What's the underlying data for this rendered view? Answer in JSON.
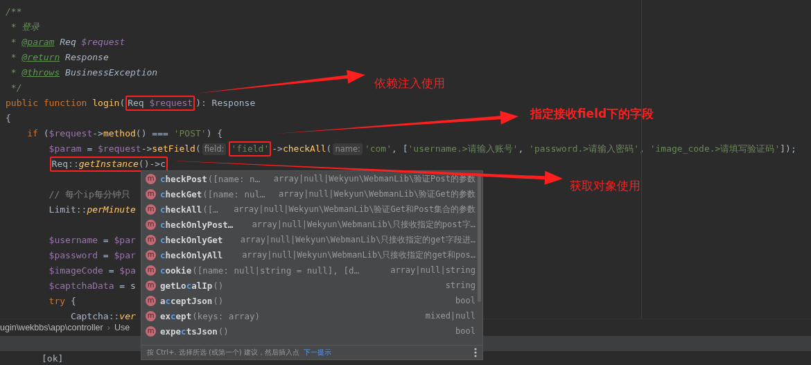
{
  "editor": {
    "lines": [
      {
        "kind": "code",
        "segments": [
          {
            "kind": "code",
            "boxed": false,
            "tokens": [
              {
                "t": "/**",
                "kind": "doc"
              }
            ]
          }
        ]
      },
      {
        "kind": "code",
        "segments": [
          {
            "kind": "code",
            "boxed": false,
            "tokens": [
              {
                "t": " * 登录",
                "kind": "doc"
              }
            ]
          }
        ]
      },
      {
        "kind": "code",
        "segments": [
          {
            "kind": "code",
            "boxed": false,
            "tokens": [
              {
                "t": " * ",
                "kind": "doc"
              },
              {
                "t": "@param",
                "kind": "doctag"
              },
              {
                "t": " Req",
                "kind": "doctype"
              },
              {
                "t": " $request",
                "kind": "docvar"
              }
            ]
          }
        ]
      },
      {
        "kind": "code",
        "segments": [
          {
            "kind": "code",
            "boxed": false,
            "tokens": [
              {
                "t": " * ",
                "kind": "doc"
              },
              {
                "t": "@return",
                "kind": "doctag"
              },
              {
                "t": " Response",
                "kind": "doctype"
              }
            ]
          }
        ]
      },
      {
        "kind": "code",
        "segments": [
          {
            "kind": "code",
            "boxed": false,
            "tokens": [
              {
                "t": " * ",
                "kind": "doc"
              },
              {
                "t": "@throws",
                "kind": "doctag"
              },
              {
                "t": " BusinessException",
                "kind": "doctype"
              }
            ]
          }
        ]
      },
      {
        "kind": "code",
        "segments": [
          {
            "kind": "code",
            "boxed": false,
            "tokens": [
              {
                "t": " */",
                "kind": "doc"
              }
            ]
          }
        ]
      },
      {
        "kind": "code",
        "segments": [
          {
            "kind": "code",
            "boxed": false,
            "tokens": [
              {
                "t": "public function ",
                "kind": "keyword"
              },
              {
                "t": "login",
                "kind": "func"
              },
              {
                "t": "(",
                "kind": "plain"
              }
            ]
          },
          {
            "kind": "code",
            "boxed": true,
            "tokens": [
              {
                "t": "Req ",
                "kind": "plain"
              },
              {
                "t": "$request",
                "kind": "var"
              }
            ]
          },
          {
            "kind": "code",
            "boxed": false,
            "tokens": [
              {
                "t": "): Response",
                "kind": "plain"
              }
            ]
          }
        ]
      },
      {
        "kind": "code",
        "segments": [
          {
            "kind": "code",
            "boxed": false,
            "tokens": [
              {
                "t": "{",
                "kind": "plain"
              }
            ]
          }
        ],
        "children": [
          {
            "kind": "code",
            "segments": [
              {
                "kind": "code",
                "boxed": false,
                "tokens": [
                  {
                    "t": "if",
                    "kind": "keyword"
                  },
                  {
                    "t": " (",
                    "kind": "plain"
                  },
                  {
                    "t": "$request",
                    "kind": "var"
                  },
                  {
                    "t": "->",
                    "kind": "plain"
                  },
                  {
                    "t": "method",
                    "kind": "func"
                  },
                  {
                    "t": "() === ",
                    "kind": "plain"
                  },
                  {
                    "t": "'POST'",
                    "kind": "string"
                  },
                  {
                    "t": ") {",
                    "kind": "plain"
                  }
                ]
              }
            ],
            "children": [
              {
                "kind": "code",
                "segments": [
                  {
                    "kind": "code",
                    "boxed": false,
                    "tokens": [
                      {
                        "t": "$param",
                        "kind": "var"
                      },
                      {
                        "t": " = ",
                        "kind": "plain"
                      },
                      {
                        "t": "$request",
                        "kind": "var"
                      },
                      {
                        "t": "->",
                        "kind": "plain"
                      },
                      {
                        "t": "setField",
                        "kind": "func"
                      },
                      {
                        "t": "(",
                        "kind": "plain"
                      }
                    ]
                  },
                  {
                    "kind": "hint",
                    "boxed": false,
                    "tokens": [
                      {
                        "t": "field:",
                        "kind": "hint"
                      }
                    ]
                  },
                  {
                    "kind": "code",
                    "boxed": true,
                    "tokens": [
                      {
                        "t": "'field'",
                        "kind": "string"
                      }
                    ]
                  },
                  {
                    "kind": "code",
                    "boxed": false,
                    "tokens": [
                      {
                        "t": "->",
                        "kind": "plain"
                      },
                      {
                        "t": "checkAll",
                        "kind": "func"
                      },
                      {
                        "t": "(",
                        "kind": "plain"
                      }
                    ]
                  },
                  {
                    "kind": "hint",
                    "boxed": false,
                    "tokens": [
                      {
                        "t": "name:",
                        "kind": "hint"
                      }
                    ]
                  },
                  {
                    "kind": "code",
                    "boxed": false,
                    "tokens": [
                      {
                        "t": "'com'",
                        "kind": "string"
                      },
                      {
                        "t": ", [",
                        "kind": "plain"
                      },
                      {
                        "t": "'username.>请输入账号'",
                        "kind": "string"
                      },
                      {
                        "t": ", ",
                        "kind": "plain"
                      },
                      {
                        "t": "'password.>请输入密码'",
                        "kind": "string"
                      },
                      {
                        "t": ", ",
                        "kind": "plain"
                      },
                      {
                        "t": "'image_code.>请填写验证码'",
                        "kind": "string"
                      },
                      {
                        "t": "]);",
                        "kind": "plain"
                      }
                    ]
                  }
                ]
              },
              {
                "kind": "code",
                "segments": [
                  {
                    "kind": "code",
                    "boxed": true,
                    "tokens": [
                      {
                        "t": "Req::",
                        "kind": "plain"
                      },
                      {
                        "t": "getInstance",
                        "kind": "static"
                      },
                      {
                        "t": "()->c",
                        "kind": "plain"
                      }
                    ]
                  }
                ]
              },
              {
                "kind": "blank"
              },
              {
                "kind": "code",
                "segments": [
                  {
                    "kind": "code",
                    "boxed": false,
                    "tokens": [
                      {
                        "t": "// 每个ip每分钟只",
                        "kind": "comment"
                      }
                    ]
                  }
                ]
              },
              {
                "kind": "code",
                "segments": [
                  {
                    "kind": "code",
                    "boxed": false,
                    "tokens": [
                      {
                        "t": "Limit::",
                        "kind": "plain"
                      },
                      {
                        "t": "perMinute",
                        "kind": "static"
                      }
                    ]
                  }
                ]
              },
              {
                "kind": "blank"
              },
              {
                "kind": "code",
                "segments": [
                  {
                    "kind": "code",
                    "boxed": false,
                    "tokens": [
                      {
                        "t": "$username",
                        "kind": "var"
                      },
                      {
                        "t": " = ",
                        "kind": "plain"
                      },
                      {
                        "t": "$par",
                        "kind": "var"
                      }
                    ]
                  }
                ]
              },
              {
                "kind": "code",
                "segments": [
                  {
                    "kind": "code",
                    "boxed": false,
                    "tokens": [
                      {
                        "t": "$password",
                        "kind": "var"
                      },
                      {
                        "t": " = ",
                        "kind": "plain"
                      },
                      {
                        "t": "$par",
                        "kind": "var"
                      }
                    ]
                  }
                ]
              },
              {
                "kind": "code",
                "segments": [
                  {
                    "kind": "code",
                    "boxed": false,
                    "tokens": [
                      {
                        "t": "$imageCode",
                        "kind": "var"
                      },
                      {
                        "t": " = ",
                        "kind": "plain"
                      },
                      {
                        "t": "$pa",
                        "kind": "var"
                      }
                    ]
                  }
                ]
              },
              {
                "kind": "code",
                "segments": [
                  {
                    "kind": "code",
                    "boxed": false,
                    "tokens": [
                      {
                        "t": "$captchaData",
                        "kind": "var"
                      },
                      {
                        "t": " = s",
                        "kind": "plain"
                      }
                    ]
                  }
                ]
              },
              {
                "kind": "code",
                "segments": [
                  {
                    "kind": "code",
                    "boxed": false,
                    "tokens": [
                      {
                        "t": "try",
                        "kind": "keyword"
                      },
                      {
                        "t": " {",
                        "kind": "plain"
                      }
                    ]
                  }
                ],
                "children": [
                  {
                    "kind": "code",
                    "segments": [
                      {
                        "kind": "code",
                        "boxed": false,
                        "tokens": [
                          {
                            "t": "Captcha::",
                            "kind": "plain"
                          },
                          {
                            "t": "ver",
                            "kind": "static"
                          }
                        ]
                      }
                    ]
                  }
                ]
              }
            ]
          }
        ]
      }
    ]
  },
  "completion_popup": {
    "items": [
      {
        "icon_letter": "m",
        "name": [
          {
            "text": "c",
            "match": true
          },
          {
            "text": "heckPost",
            "match": false
          }
        ],
        "params": "([name: n…",
        "type": "array|null|Wekyun\\WebmanLib\\验证Post的参数"
      },
      {
        "icon_letter": "m",
        "name": [
          {
            "text": "c",
            "match": true
          },
          {
            "text": "heckGet",
            "match": false
          }
        ],
        "params": "([name: nul…",
        "type": "array|null|Wekyun\\WebmanLib\\验证Get的参数"
      },
      {
        "icon_letter": "m",
        "name": [
          {
            "text": "c",
            "match": true
          },
          {
            "text": "heckAll",
            "match": false
          }
        ],
        "params": "([…",
        "type": "array|null|Wekyun\\WebmanLib\\验证Get和Post集合的参数"
      },
      {
        "icon_letter": "m",
        "name": [
          {
            "text": "c",
            "match": true
          },
          {
            "text": "heckOnlyPost…",
            "match": false
          }
        ],
        "type": "array|null|Wekyun\\WebmanLib\\只接收指定的post字…"
      },
      {
        "icon_letter": "m",
        "name": [
          {
            "text": "c",
            "match": true
          },
          {
            "text": "heckOnlyGet",
            "match": false
          }
        ],
        "type": "array|null|Wekyun\\WebmanLib\\只接收指定的get字段进…"
      },
      {
        "icon_letter": "m",
        "name": [
          {
            "text": "c",
            "match": true
          },
          {
            "text": "heckOnlyAll",
            "match": false
          }
        ],
        "type": "array|null|Wekyun\\WebmanLib\\只接收指定的get和pos…"
      },
      {
        "icon_letter": "m",
        "name": [
          {
            "text": "c",
            "match": true
          },
          {
            "text": "ookie",
            "match": false
          }
        ],
        "params": "([name: null|string = null], [d…",
        "type": "array|null|string"
      },
      {
        "icon_letter": "m",
        "name": [
          {
            "text": "getLo",
            "match": false
          },
          {
            "text": "c",
            "match": true
          },
          {
            "text": "alIp",
            "match": false
          }
        ],
        "params": "()",
        "type": "string"
      },
      {
        "icon_letter": "m",
        "name": [
          {
            "text": "a",
            "match": false
          },
          {
            "text": "c",
            "match": true
          },
          {
            "text": "ceptJson",
            "match": false
          }
        ],
        "params": "()",
        "type": "bool"
      },
      {
        "icon_letter": "m",
        "name": [
          {
            "text": "ex",
            "match": false
          },
          {
            "text": "c",
            "match": true
          },
          {
            "text": "ept",
            "match": false
          }
        ],
        "params": "(keys: array)",
        "type": "mixed|null"
      },
      {
        "icon_letter": "m",
        "name": [
          {
            "text": "expe",
            "match": false
          },
          {
            "text": "c",
            "match": true
          },
          {
            "text": "tsJson",
            "match": false
          }
        ],
        "params": "()",
        "type": "bool"
      }
    ],
    "footer": {
      "hint": "按 Ctrl+. 选择所选 (或第一个) 建议，然后插入点",
      "link": "下一提示"
    }
  },
  "breadcrumb": {
    "path": "ugin\\wekbbs\\app\\controller",
    "separator": "›",
    "current": "Use"
  },
  "console": {
    "text": "[ok]"
  },
  "annotations": [
    {
      "label": "依赖注入使用",
      "bold": false
    },
    {
      "label": "指定接收field下的字段",
      "bold": true
    },
    {
      "label": "获取对象使用",
      "bold": false
    }
  ]
}
